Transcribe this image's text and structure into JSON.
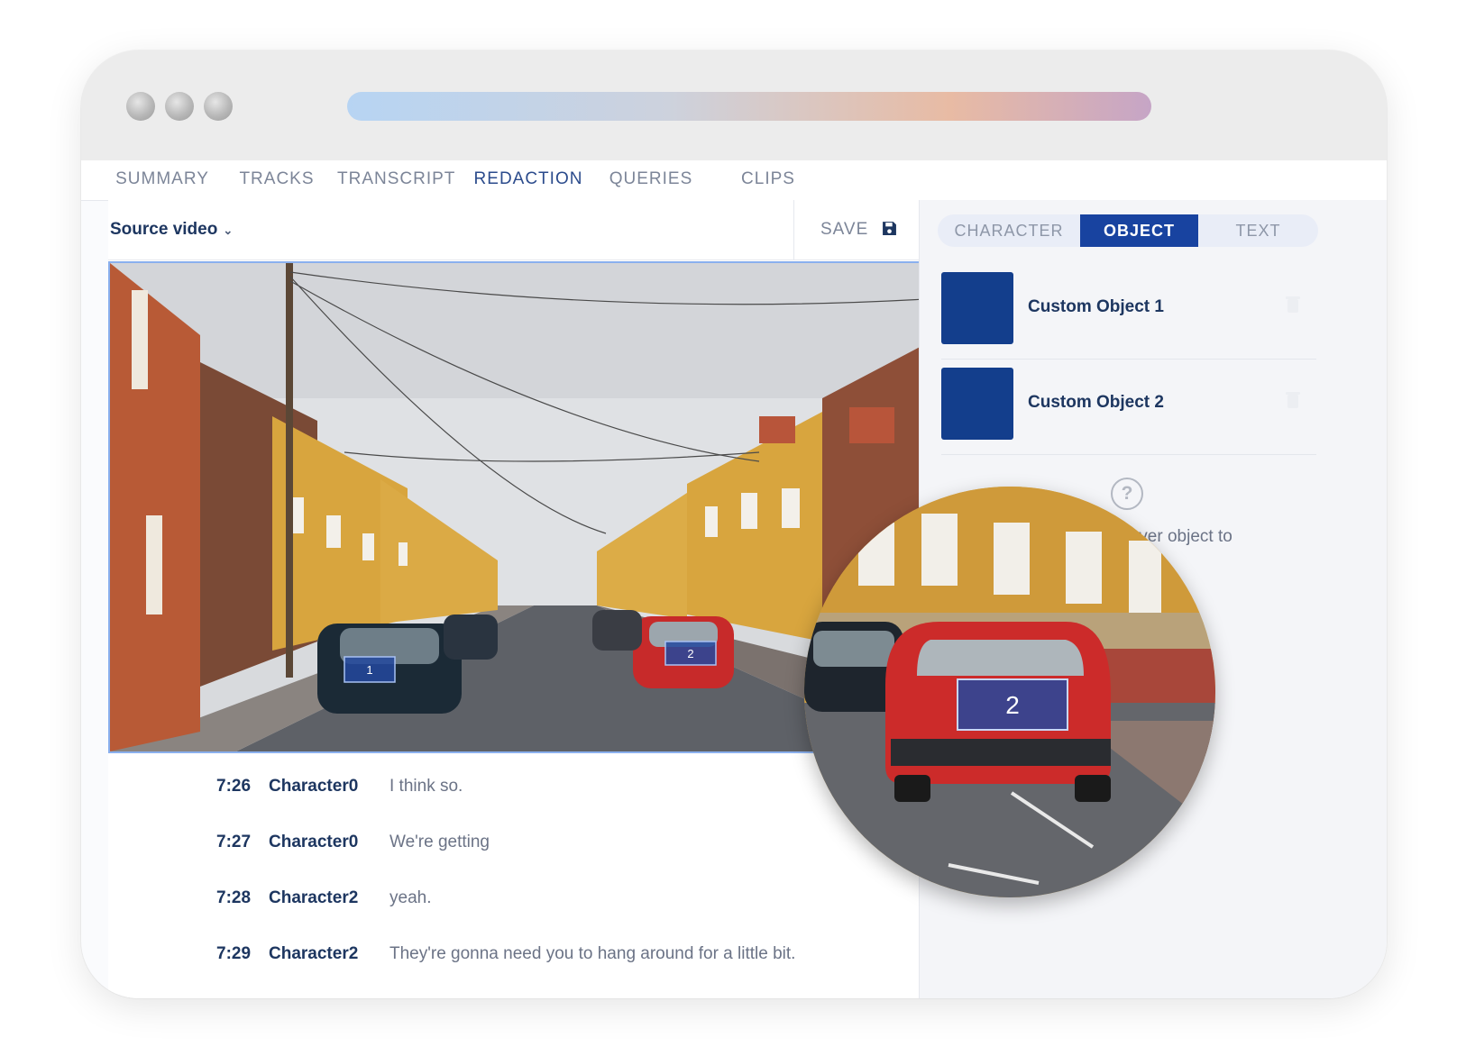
{
  "nav_tabs": [
    "SUMMARY",
    "TRACKS",
    "TRANSCRIPT",
    "REDACTION",
    "QUERIES",
    "CLIPS"
  ],
  "active_tab": "REDACTION",
  "source": {
    "label": "Source video",
    "dropdown_icon": "chevron-down-icon"
  },
  "save": {
    "label": "SAVE",
    "icon": "floppy-disk-icon"
  },
  "redaction_tabs": [
    "CHARACTER",
    "OBJECT",
    "TEXT"
  ],
  "active_redaction_tab": "OBJECT",
  "objects": [
    {
      "name": "Custom Object 1",
      "color": "#133e8c"
    },
    {
      "name": "Custom Object 2",
      "color": "#133e8c"
    }
  ],
  "help": {
    "icon": "question-circle-icon",
    "text": "rag over object to"
  },
  "video": {
    "markers": [
      "1",
      "2"
    ],
    "zoom_marker": "2"
  },
  "transcript": [
    {
      "time": "7:26",
      "character": "Character0",
      "text": "I think so."
    },
    {
      "time": "7:27",
      "character": "Character0",
      "text": "We're getting"
    },
    {
      "time": "7:28",
      "character": "Character2",
      "text": "yeah."
    },
    {
      "time": "7:29",
      "character": "Character2",
      "text": "They're gonna need you to hang around for a little bit."
    }
  ],
  "colors": {
    "accent": "#1843a0",
    "text_dark": "#1d3660",
    "text_muted": "#7c8598",
    "selection_border": "#8ab0ee"
  }
}
